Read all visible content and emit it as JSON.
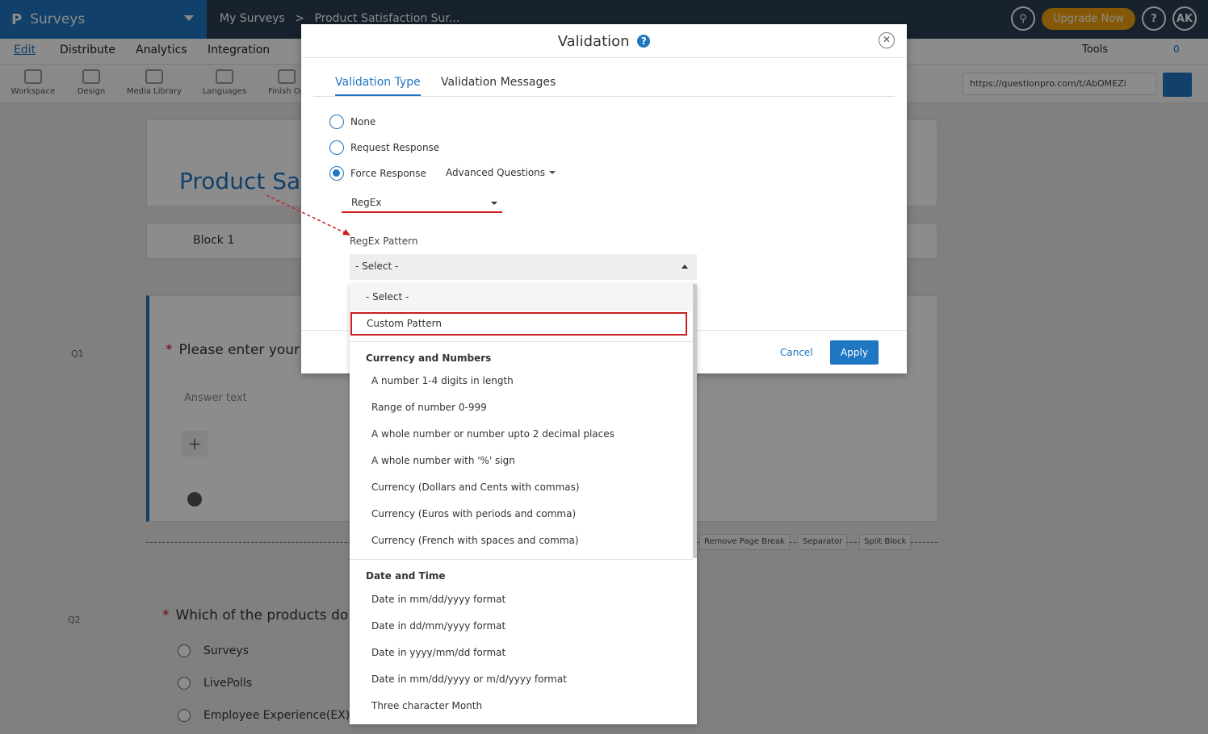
{
  "app": {
    "brand": "Surveys",
    "breadcrumb": [
      "My Surveys",
      ">",
      "Product Satisfaction Sur..."
    ],
    "upgrade_label": "Upgrade Now",
    "help_label": "?",
    "avatar_initials": "AK"
  },
  "menu": {
    "items": [
      "Edit",
      "Distribute",
      "Analytics",
      "Integration"
    ],
    "tools_label": "Tools",
    "collab_count": "0"
  },
  "toolbar": {
    "items": [
      "Workspace",
      "Design",
      "Media Library",
      "Languages",
      "Finish Op"
    ],
    "survey_url": "https://questionpro.com/t/AbOMEZi"
  },
  "survey": {
    "title": "Product Sat",
    "block_label": "Block 1",
    "q1": {
      "number": "Q1",
      "text": "Please enter your",
      "answer_placeholder": "Answer text"
    },
    "q2": {
      "number": "Q2",
      "text": "Which of the products do",
      "options": [
        "Surveys",
        "LivePolls",
        "Employee Experience(EX)"
      ]
    },
    "page_actions": [
      "Remove Page Break",
      "Separator",
      "Split Block"
    ]
  },
  "modal": {
    "title": "Validation",
    "tabs": [
      "Validation Type",
      "Validation Messages"
    ],
    "options": [
      "None",
      "Request Response",
      "Force Response"
    ],
    "selected_option": "Force Response",
    "advanced_label": "Advanced Questions",
    "type_select": "RegEx",
    "pattern_label": "RegEx Pattern",
    "pattern_select": "- Select -",
    "cancel_label": "Cancel",
    "apply_label": "Apply"
  },
  "dropdown": {
    "first": "- Select -",
    "custom": "Custom Pattern",
    "groups": [
      {
        "label": "Currency and Numbers",
        "items": [
          "A number 1-4 digits in length",
          "Range of number 0-999",
          "A whole number or number upto 2 decimal places",
          "A whole number with '%' sign",
          "Currency (Dollars and Cents with commas)",
          "Currency (Euros with periods and comma)",
          "Currency (French with spaces and comma)"
        ]
      },
      {
        "label": "Date and Time",
        "items": [
          "Date in mm/dd/yyyy format",
          "Date in dd/mm/yyyy format",
          "Date in yyyy/mm/dd format",
          "Date in mm/dd/yyyy or m/d/yyyy format",
          "Three character Month"
        ]
      }
    ]
  },
  "colors": {
    "primary": "#1f76c2",
    "topbar": "#2a3f55",
    "upgrade": "#f0a10c",
    "highlight_red": "#cc1f1f"
  }
}
